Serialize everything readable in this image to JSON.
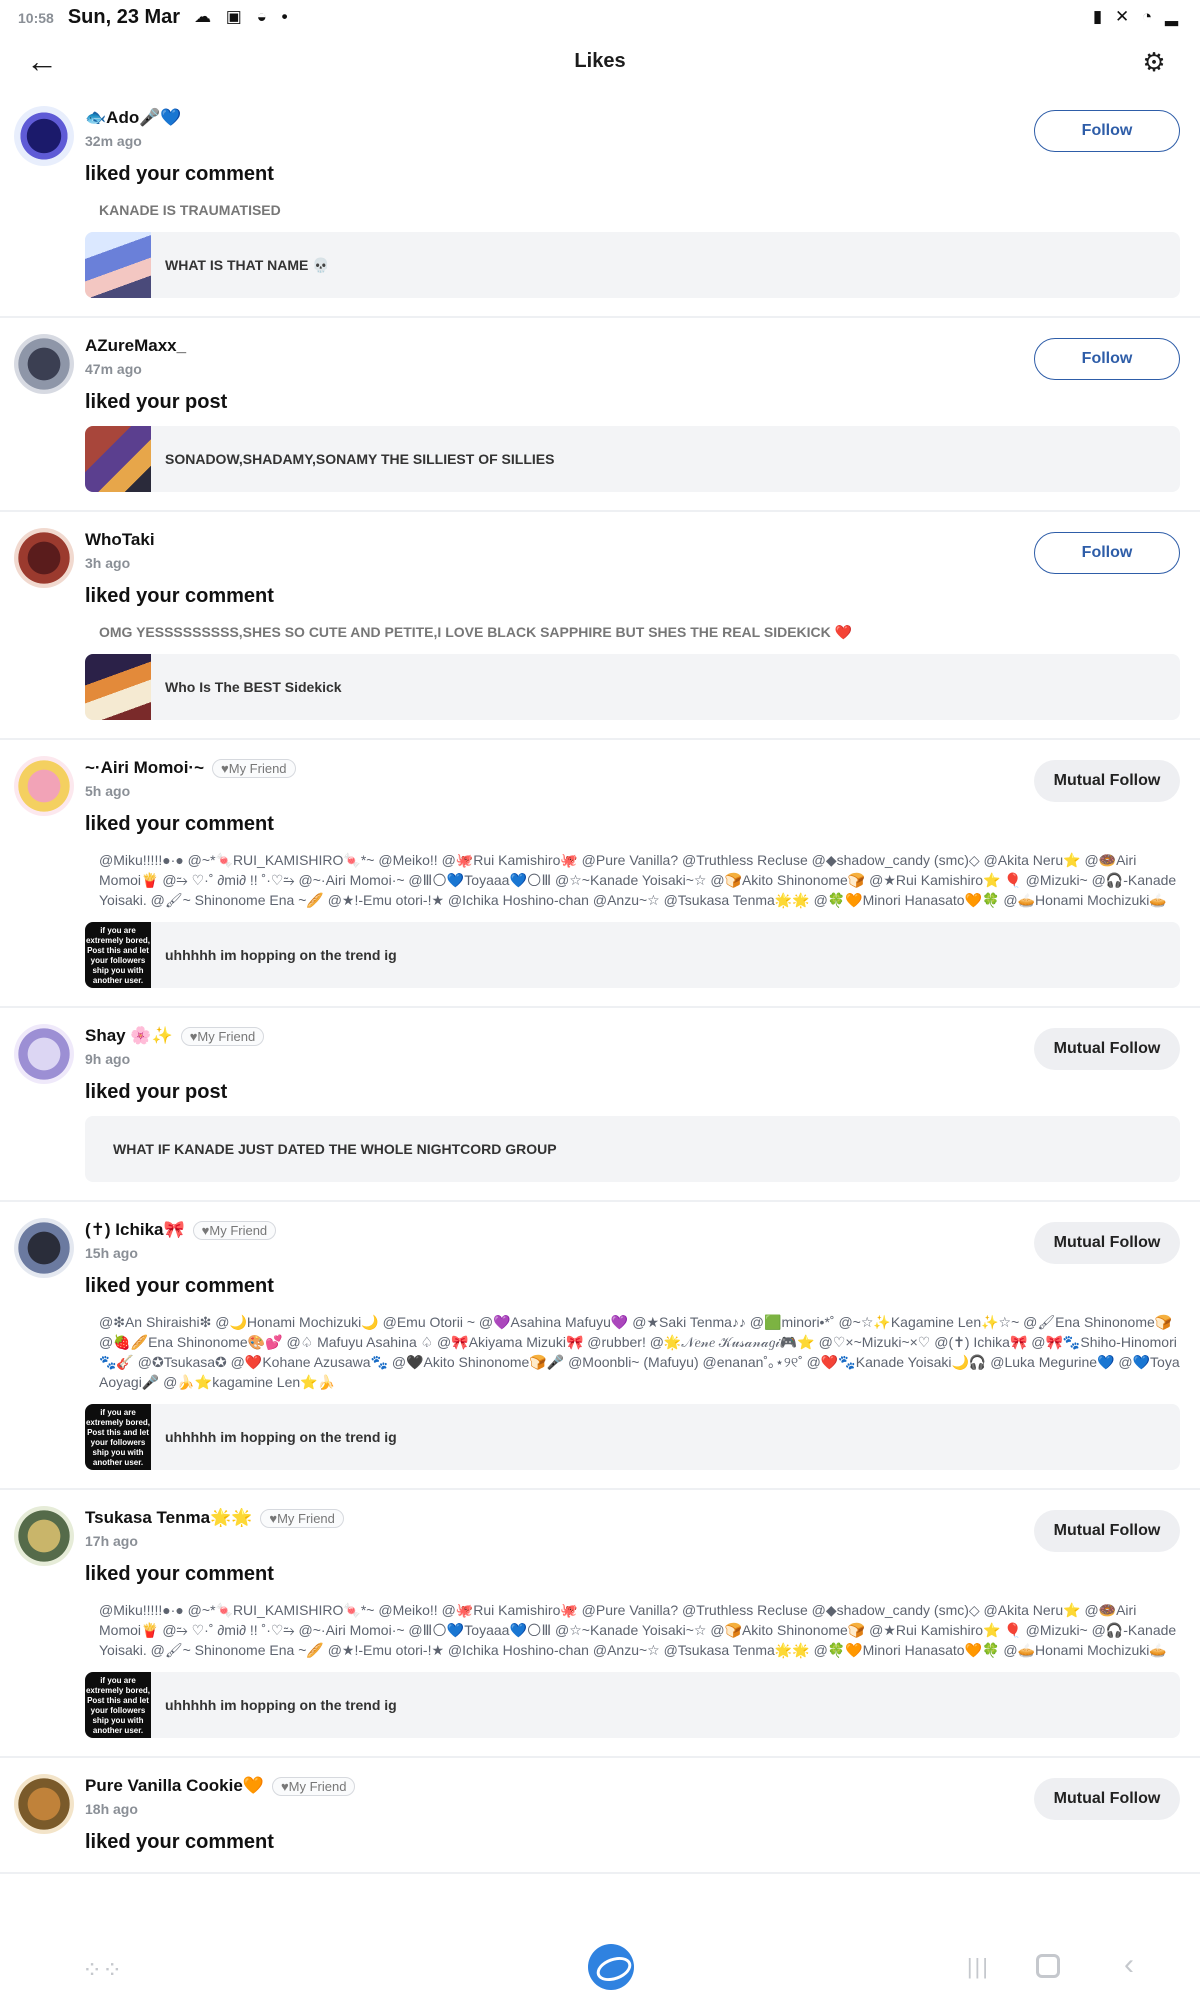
{
  "status_bar": {
    "time": "10:58",
    "date": "Sun, 23 Mar",
    "left_icons": "☁ ▣ ◒ •",
    "right_icons": "▮ ✕ ◔ ▂"
  },
  "header": {
    "title": "Likes",
    "back_icon": "←",
    "settings_icon": "⚙"
  },
  "items": [
    {
      "name": "🐟Ado🎤💙",
      "time": "32m ago",
      "action": "liked your comment",
      "comment": "KANADE IS TRAUMATISED",
      "snippet": "WHAT IS THAT NAME 💀",
      "button": "Follow"
    },
    {
      "name": "AZureMaxx_",
      "time": "47m ago",
      "action": "liked your post",
      "snippet": "SONADOW,SHADAMY,SONAMY THE SILLIEST OF SILLIES",
      "button": "Follow"
    },
    {
      "name": "WhoTaki",
      "time": "3h ago",
      "action": "liked your comment",
      "comment": "OMG YESSSSSSSSS,SHES SO CUTE AND PETITE,I LOVE BLACK SAPPHIRE BUT SHES THE REAL SIDEKICK ❤️",
      "snippet": "Who Is The BEST Sidekick",
      "button": "Follow"
    },
    {
      "name": "~·Airi Momoi·~",
      "badge": "♥My Friend",
      "time": "5h ago",
      "action": "liked your comment",
      "comment": "@Miku!!!!!●·● @~*🍬RUI_KAMISHIRO🍬*~ @Meiko!! @🐙Rui Kamishiro🐙 @Pure Vanilla? @Truthless Recluse @◆shadow_candy (smc)◇ @Akita Neru⭐ @🍩Airi Momoi🍟 @⥲ ♡·˚ ∂mi∂ !! ˚·♡⥲ @~·Airi Momoi·~ @Ⅲ🌕💙Toyaaa💙🌕Ⅲ @☆~Kanade Yoisaki~☆ @🍞Akito Shinonome🍞 @★Rui Kamishiro⭐ 🎈 @Mizuki~ @🎧-Kanade Yoisaki. @🖌~ Shinonome Ena ~🥖 @★!-Emu otori-!★ @Ichika Hoshino-chan @Anzu~☆ @Tsukasa Tenma🌟🌟 @🍀🧡Minori Hanasato🧡🍀 @🥧Honami Mochizuki🥧",
      "snippet": "uhhhhh im hopping on the trend ig",
      "thumb_text": "if you are extremely bored, Post this and let your followers ship you with another user.",
      "button": "Mutual Follow"
    },
    {
      "name": "Shay 🌸✨",
      "badge": "♥My Friend",
      "time": "9h ago",
      "action": "liked your post",
      "snippet": "WHAT IF KANADE JUST DATED THE WHOLE NIGHTCORD GROUP",
      "button": "Mutual Follow"
    },
    {
      "name": "(✝) Ichika🎀",
      "badge": "♥My Friend",
      "time": "15h ago",
      "action": "liked your comment",
      "comment": "@❇An Shiraishi❇ @🌙Honami Mochizuki🌙 @Emu Otorii ~ @💜Asahina Mafuyu💜 @★Saki Tenma♪♪ @🟩minori•*˚ @~☆✨Kagamine Len✨☆~ @🖌Ena Shinonome🍞 @🍓🥖Ena Shinonome🎨💕 @♤ Mafuyu Asahina ♤ @🎀Akiyama Mizuki🎀 @rubber! @🌟𝒩𝑒𝓃𝑒 𝒦𝓊𝓈𝒶𝓃𝒶𝑔𝒾🎮⭐ @♡×~Mizuki~×♡ @(✝) Ichika🎀 @🎀🐾Shiho-Hinomori🐾🎸 @✪Tsukasa✪ @❤️Kohane Azusawa🐾 @🖤Akito Shinonome🍞🎤 @Moonbli~ (Mafuyu) @enanan˚｡⋆୨୧˚ @❤️🐾Kanade Yoisaki🌙🎧 @Luka Megurine💙 @💙Toya Aoyagi🎤 @🍌⭐kagamine Len⭐🍌",
      "snippet": "uhhhhh im hopping on the trend ig",
      "thumb_text": "if you are extremely bored, Post this and let your followers ship you with another user.",
      "button": "Mutual Follow"
    },
    {
      "name": "Tsukasa Tenma🌟🌟",
      "badge": "♥My Friend",
      "time": "17h ago",
      "action": "liked your comment",
      "comment": "@Miku!!!!!●·● @~*🍬RUI_KAMISHIRO🍬*~ @Meiko!! @🐙Rui Kamishiro🐙 @Pure Vanilla? @Truthless Recluse @◆shadow_candy (smc)◇ @Akita Neru⭐ @🍩Airi Momoi🍟 @⥲ ♡·˚ ∂mi∂ !! ˚·♡⥲ @~·Airi Momoi·~ @Ⅲ🌕💙Toyaaa💙🌕Ⅲ @☆~Kanade Yoisaki~☆ @🍞Akito Shinonome🍞 @★Rui Kamishiro⭐ 🎈 @Mizuki~ @🎧-Kanade Yoisaki. @🖌~ Shinonome Ena ~🥖 @★!-Emu otori-!★ @Ichika Hoshino-chan @Anzu~☆ @Tsukasa Tenma🌟🌟 @🍀🧡Minori Hanasato🧡🍀 @🥧Honami Mochizuki🥧",
      "snippet": "uhhhhh im hopping on the trend ig",
      "thumb_text": "if you are extremely bored, Post this and let your followers ship you with another user.",
      "button": "Mutual Follow"
    },
    {
      "name": "Pure Vanilla Cookie🧡",
      "badge": "♥My Friend",
      "time": "18h ago",
      "action": "liked your comment",
      "button": "Mutual Follow"
    }
  ],
  "navbar": {
    "apps_icon": "⁘⁘",
    "recents_icon": "|||",
    "back_icon": "‹"
  },
  "colors": {
    "accent": "#2e5da8",
    "mutual_bg": "#eeeff2",
    "snippet_bg": "#f3f4f6"
  }
}
